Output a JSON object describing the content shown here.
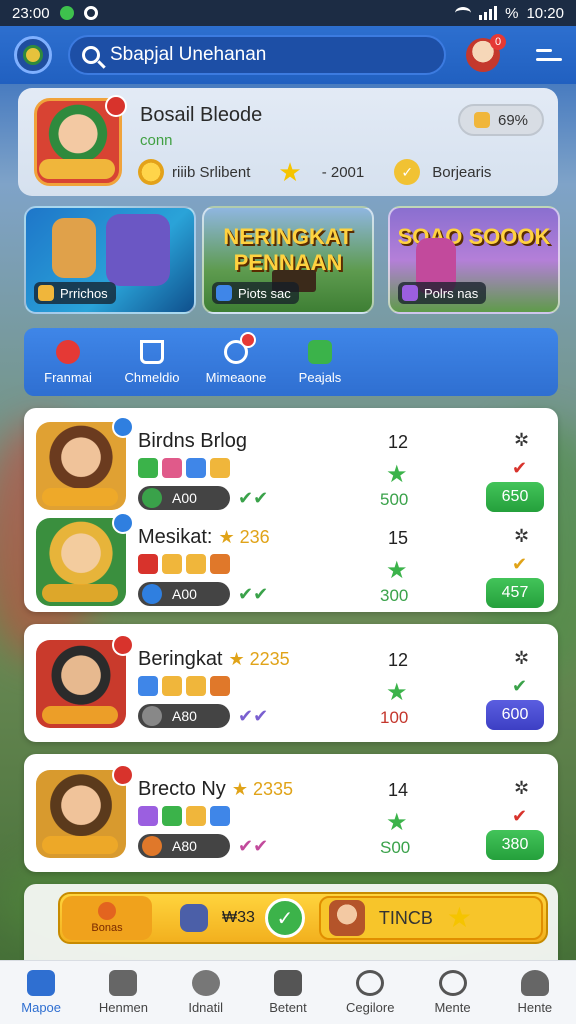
{
  "status_bar": {
    "time_left": "23:00",
    "battery": "%",
    "time_right": "10:20"
  },
  "app_bar": {
    "search_text": "Sbapjal Unehanan",
    "avatar_badge": "0"
  },
  "profile": {
    "name": "Bosail Bleode",
    "subtitle": "conn",
    "percent": "69%",
    "coin_label": "riiib Srlibent",
    "score": "- 2001",
    "extra_label": "Borjearis"
  },
  "banners": [
    {
      "headline": "",
      "tag": "Prrichos"
    },
    {
      "headline": "NERINGKAT PENNAAN",
      "tag": "Piots sac"
    },
    {
      "headline": "SOAO SOOOK",
      "tag": "Polrs nas"
    }
  ],
  "quick_menu": [
    {
      "label": "Franmai",
      "icon": "heart-shield-icon",
      "color": "#e53935"
    },
    {
      "label": "Chmeldio",
      "icon": "home-icon",
      "color": "#ffffff"
    },
    {
      "label": "Mimeaone",
      "icon": "timer-icon",
      "color": "#ffffff"
    },
    {
      "label": "Peajals",
      "icon": "flag-icon",
      "color": "#3bb34a"
    }
  ],
  "rows": [
    {
      "name": "Birdns Brlog",
      "rating": "",
      "level": "12",
      "coins": "A00",
      "points": "500",
      "action": "650",
      "action_color": "green",
      "points_color": "green"
    },
    {
      "name": "Mesikat:",
      "rating": "★ 236",
      "level": "15",
      "coins": "A00",
      "points": "300",
      "action": "457",
      "action_color": "green",
      "points_color": "green"
    },
    {
      "name": "Beringkat",
      "rating": "★ 2235",
      "level": "12",
      "coins": "A80",
      "points": "100",
      "action": "600",
      "action_color": "blue",
      "points_color": "red"
    },
    {
      "name": "Brecto Ny",
      "rating": "★ 2335",
      "level": "14",
      "coins": "A80",
      "points": "S00",
      "action": "380",
      "action_color": "green",
      "points_color": "green"
    }
  ],
  "promo": {
    "left_label": "Bonas",
    "mid_value": "₩33",
    "right_label": "TINCB"
  },
  "bottom_nav": [
    {
      "label": "Mapoe",
      "icon": "home-icon",
      "active": true
    },
    {
      "label": "Henmen",
      "icon": "house-outline-icon",
      "active": false
    },
    {
      "label": "Idnatil",
      "icon": "face-icon",
      "active": false
    },
    {
      "label": "Betent",
      "icon": "chat-icon",
      "active": false
    },
    {
      "label": "Cegilore",
      "icon": "message-check-icon",
      "active": false
    },
    {
      "label": "Mente",
      "icon": "search-person-icon",
      "active": false
    },
    {
      "label": "Hente",
      "icon": "person-icon",
      "active": false
    }
  ]
}
